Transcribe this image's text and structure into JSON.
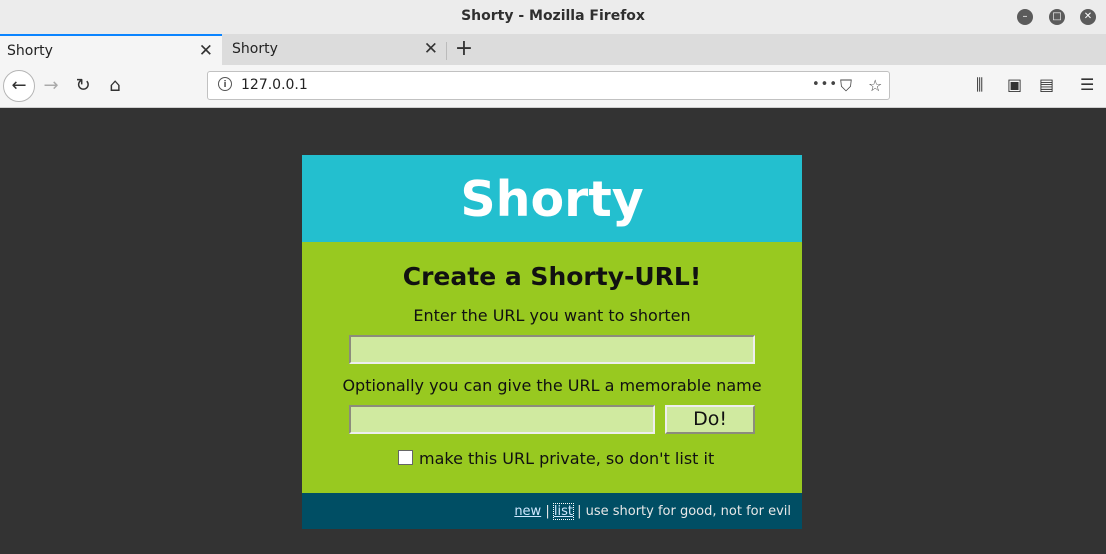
{
  "window": {
    "title": "Shorty - Mozilla Firefox"
  },
  "tabs": [
    {
      "label": "Shorty",
      "close": "✕"
    },
    {
      "label": "Shorty",
      "close": "✕"
    }
  ],
  "newtab": "+",
  "navbar": {
    "url": "127.0.0.1",
    "more": "•••"
  },
  "page": {
    "header_title": "Shorty",
    "form_heading": "Create a Shorty-URL!",
    "url_label": "Enter the URL you want to shorten",
    "url_value": "",
    "name_label": "Optionally you can give the URL a memorable name",
    "name_value": "",
    "submit_label": "Do!",
    "private_label": "make this URL private, so don't list it",
    "private_checked": false,
    "footer": {
      "new_link": "new",
      "sep1": " | ",
      "list_link": "list",
      "tagline": " | use shorty for good, not for evil"
    }
  },
  "colors": {
    "header_bg": "#23bfcf",
    "body_bg": "#98c920",
    "footer_bg": "#004e64",
    "page_bg": "#333333"
  }
}
